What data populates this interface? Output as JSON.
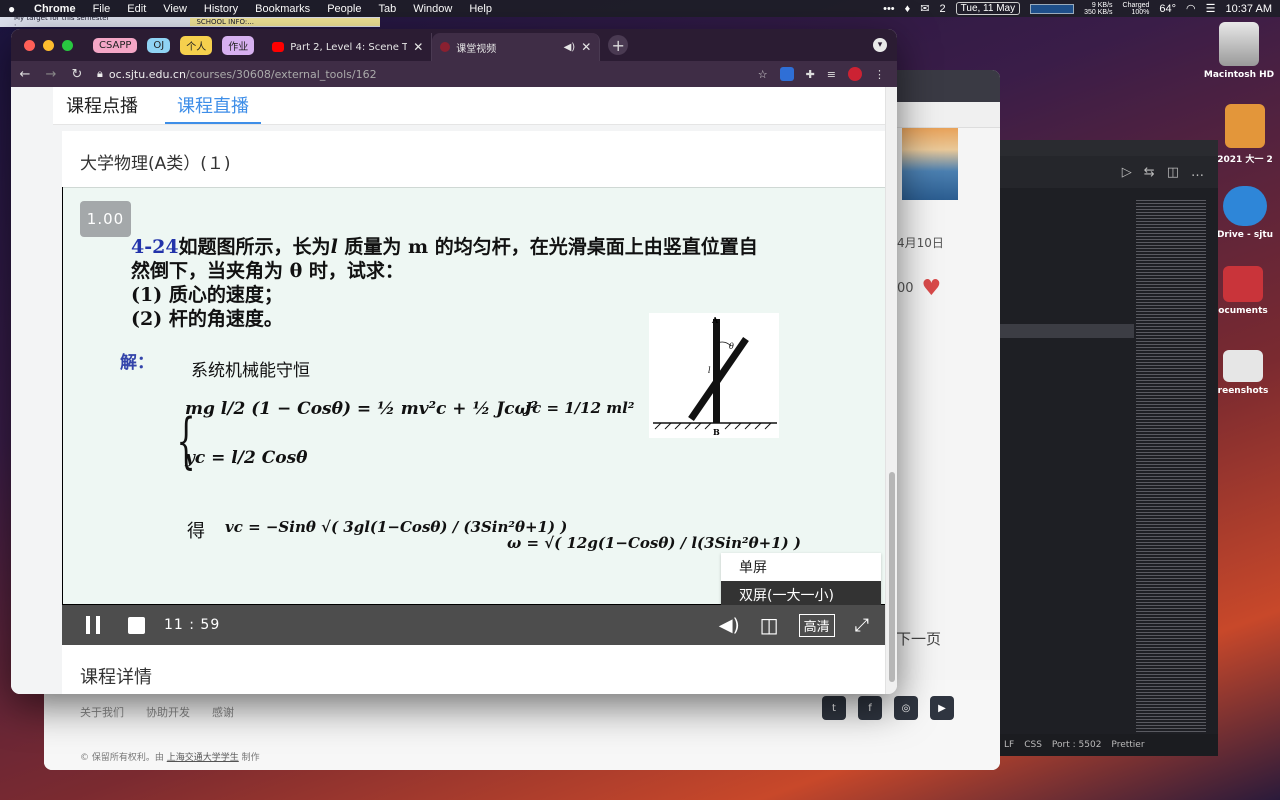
{
  "menubar": {
    "app": "Chrome",
    "items": [
      "File",
      "Edit",
      "View",
      "History",
      "Bookmarks",
      "People",
      "Tab",
      "Window",
      "Help"
    ],
    "wechat_count": "2",
    "date": "Tue, 11 May",
    "net_up": "9 KB/s",
    "net_down": "350 KB/s",
    "battery_status": "Charged",
    "battery_pct": "100%",
    "temperature": "64°",
    "time": "10:37 AM"
  },
  "bookmark_strip": {
    "item1": "My target for this semester :...",
    "item2": "SCHOOL INFO:..."
  },
  "desktop": {
    "icons": [
      {
        "label": "Macintosh HD"
      },
      {
        "label": "2021 大一 2"
      },
      {
        "label": "Drive - sjtu"
      },
      {
        "label": "ocuments"
      },
      {
        "label": "reenshots"
      }
    ]
  },
  "bg_window": {
    "date_fragment": "4月10日",
    "likes_fragment": "00",
    "next_page": "下一页",
    "footer_links": [
      "关于我们",
      "协助开发",
      "感谢"
    ],
    "copyright_prefix": "© 保留所有权利。由",
    "copyright_link": "上海交通大学学生",
    "copyright_suffix": "制作"
  },
  "editor": {
    "status": [
      "LF",
      "CSS",
      "Port : 5502",
      "Prettier"
    ]
  },
  "browser": {
    "tab_groups": [
      {
        "label": "CSAPP",
        "color": "#f4a6c6"
      },
      {
        "label": "OJ",
        "color": "#8fd3f4"
      },
      {
        "label": "个人",
        "color": "#f6d04d"
      },
      {
        "label": "作业",
        "color": "#d7b0f0"
      }
    ],
    "tabs": [
      {
        "title": "Part 2, Level 4: Scene Texturing",
        "active": false
      },
      {
        "title": "课堂视频",
        "active": true
      }
    ],
    "url_domain": "oc.sjtu.edu.cn",
    "url_path": "/courses/30608/external_tools/162"
  },
  "page": {
    "tabs": [
      "课程点播",
      "课程直播"
    ],
    "active_tab": "课程直播",
    "course_title": "大学物理(A类）(１)",
    "course_detail": "课程详情"
  },
  "player": {
    "speed": "1.00",
    "time": "11 : 59",
    "quality_label": "高清",
    "menu_options": [
      "单屏",
      "双屏(一大一小)"
    ],
    "selected_option": "双屏(一大一小)"
  },
  "slide": {
    "problem_number": "4-24",
    "problem_line1": "如题图所示，长为",
    "problem_var_l": "l",
    "problem_line1b": " 质量为 ",
    "problem_var_m": "m",
    "problem_line1c": " 的均匀杆，在光滑桌面上由竖直位置自",
    "problem_line2a": "然倒下，当夹角为 ",
    "problem_var_theta": "θ",
    "problem_line2b": " 时，试求：",
    "problem_q1": "(1) 质心的速度；",
    "problem_q2": "(2) 杆的角速度。",
    "solution_label": "解：",
    "solution_text": "系统机械能守恒",
    "eq1": "mg l/2 (1 − Cosθ) = ½ mv²c + ½ Jcω²",
    "eq_inertia": "Jc = 1/12 ml²",
    "eq2": "yc = l/2 Cosθ",
    "result_label": "得",
    "eq_vc": "vc = −Sinθ √( 3gl(1−Cosθ) / (3Sin²θ+1) )",
    "eq_omega": "ω = √( 12g(1−Cosθ) / l(3Sin²θ+1) )",
    "fig_top": "A",
    "fig_bottom": "B",
    "fig_angle": "θ",
    "fig_length": "l"
  }
}
